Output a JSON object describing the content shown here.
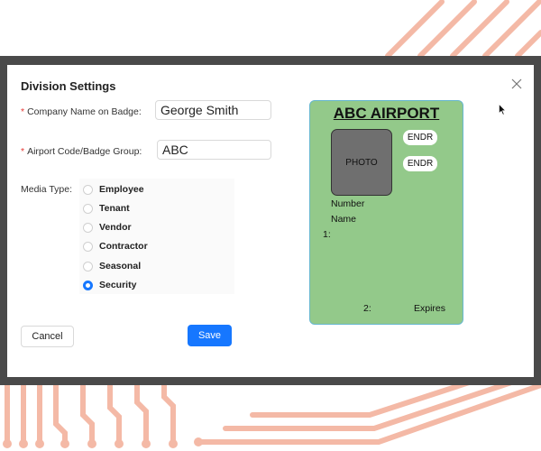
{
  "dialog": {
    "title": "Division Settings",
    "close_icon": "close-icon"
  },
  "form": {
    "company_name": {
      "label": "Company Name on Badge:",
      "required_mark": "*",
      "value": "George Smith"
    },
    "airport_code": {
      "label": "Airport Code/Badge Group:",
      "required_mark": "*",
      "value": "ABC"
    },
    "media_type": {
      "label": "Media Type:",
      "selected": "Security",
      "options": [
        "Employee",
        "Tenant",
        "Vendor",
        "Contractor",
        "Seasonal",
        "Security"
      ]
    }
  },
  "buttons": {
    "cancel_label": "Cancel",
    "save_label": "Save"
  },
  "badge_preview": {
    "title": "ABC AIRPORT",
    "photo_label": "PHOTO",
    "endorsements": [
      "ENDR",
      "ENDR"
    ],
    "number_label": "Number",
    "name_label": "Name",
    "line1_label": "1:",
    "line2_label": "2:",
    "expires_label": "Expires",
    "background_color": "#93c98a"
  },
  "colors": {
    "accent": "#1677ff",
    "frame": "#4a4a4a",
    "decor": "#f4b9a6"
  }
}
